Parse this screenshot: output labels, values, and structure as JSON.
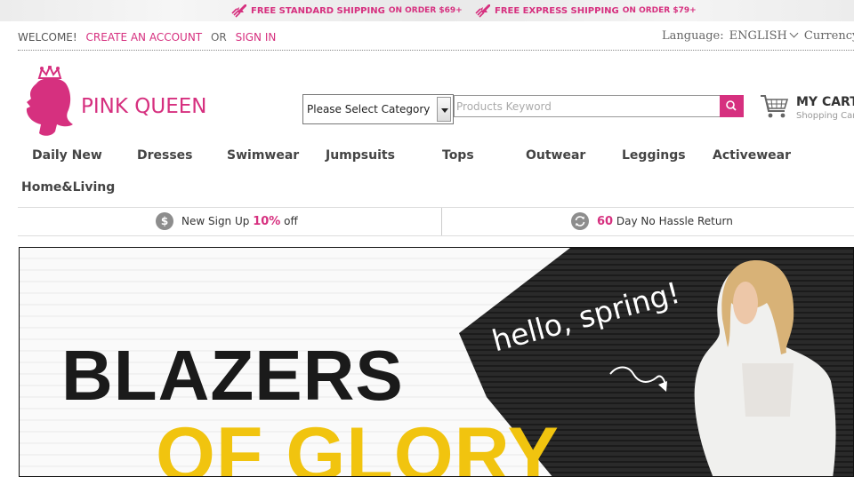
{
  "promo": {
    "item1_main": "FREE STANDARD SHIPPING",
    "item1_sub": "ON ORDER $69+",
    "item2_main": "FREE EXPRESS SHIPPING",
    "item2_sub": "ON ORDER $79+"
  },
  "topbar": {
    "welcome": "WELCOME!",
    "create_account": "CREATE AN ACCOUNT",
    "or": "OR",
    "sign_in": "SIGN IN",
    "language_label": "Language:",
    "language_value": "ENGLISH",
    "currency_label": "Currency"
  },
  "logo": {
    "text": "PINK QUEEN"
  },
  "search": {
    "category": "Please Select Category",
    "placeholder": "Products Keyword"
  },
  "cart": {
    "title": "MY CART",
    "subtitle": "Shopping Cart"
  },
  "nav": {
    "items": [
      "Daily New",
      "Dresses",
      "Swimwear",
      "Jumpsuits",
      "Tops",
      "Outwear",
      "Leggings",
      "Activewear",
      "Home&Living"
    ]
  },
  "benefits": {
    "signup_pre": "New Sign Up",
    "signup_highlight": "10%",
    "signup_post": "off",
    "return_highlight": "60",
    "return_post": "Day No Hassle Return"
  },
  "banner": {
    "line1": "BLAZERS",
    "line2": "OF GLORY",
    "tagline": "hello, spring!"
  },
  "colors": {
    "brand_pink": "#d6307f",
    "banner_yellow": "#f1c40f"
  },
  "icons": [
    "rocket-icon",
    "crown-silhouette-icon",
    "search-icon",
    "cart-icon",
    "dollar-icon",
    "return-icon"
  ]
}
